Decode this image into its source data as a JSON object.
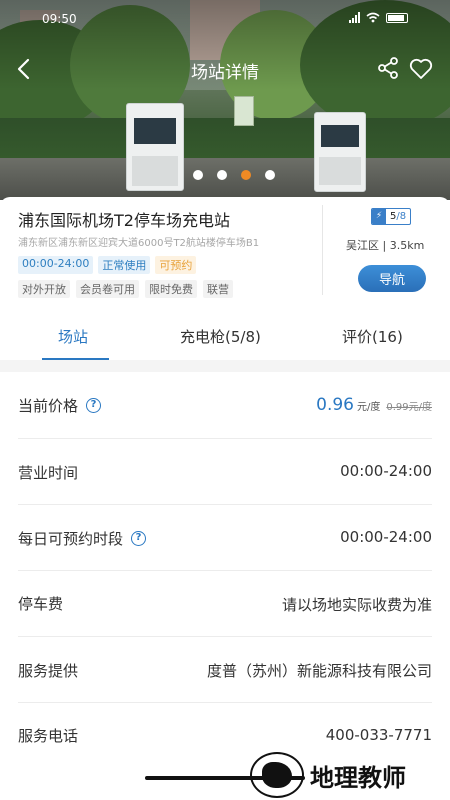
{
  "status_bar": {
    "time": "09:50"
  },
  "header": {
    "title": "场站详情"
  },
  "station": {
    "name": "浦东国际机场T2停车场充电站",
    "address": "浦东新区浦东新区迎宾大道6000号T2航站楼停车场B1",
    "tags": [
      "00:00-24:00",
      "正常使用",
      "可预约"
    ],
    "features": [
      "对外开放",
      "会员卷可用",
      "限时免费",
      "联营"
    ],
    "charger_count": {
      "available": "5",
      "total": "/8"
    },
    "district_distance": "吴江区 | 3.5km",
    "navigate_label": "导航"
  },
  "gallery": {
    "slide_count": 4,
    "active_index": 2
  },
  "tabs": [
    {
      "label": "场站"
    },
    {
      "label": "充电枪(5/8)"
    },
    {
      "label": "评价(16)"
    }
  ],
  "details": {
    "price": {
      "label": "当前价格",
      "value": "0.96",
      "unit": "元/度",
      "original": "0.99元/度"
    },
    "hours": {
      "label": "营业时间",
      "value": "00:00-24:00"
    },
    "reserve": {
      "label": "每日可预约时段",
      "value": "00:00-24:00"
    },
    "parking": {
      "label": "停车费",
      "value": "请以场地实际收费为准"
    },
    "provider": {
      "label": "服务提供",
      "value": "度普（苏州）新能源科技有限公司"
    },
    "phone": {
      "label": "服务电话",
      "value": "400-033-7771"
    }
  },
  "watermark": {
    "text": "地理教师"
  },
  "colors": {
    "accent": "#2a78c2",
    "reserve": "#e8a23a",
    "active_dot": "#f08a24"
  }
}
